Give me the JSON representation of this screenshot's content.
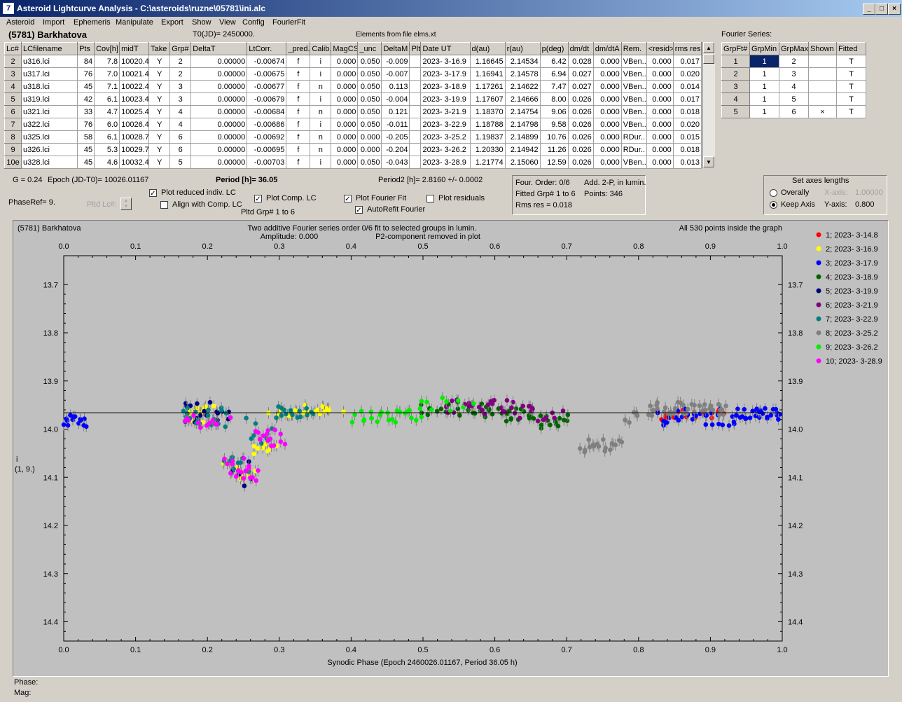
{
  "window": {
    "title": "Asteroid Lightcurve Analysis - C:\\asteroids\\ruzne\\05781\\ini.alc",
    "icon_name": "app-icon"
  },
  "menu": [
    "Asteroid",
    "Import",
    "Ephemeris",
    "Manipulate",
    "Export",
    "Show",
    "View",
    "Config",
    "FourierFit"
  ],
  "header": {
    "asteroid": "(5781) Barkhatova",
    "t0": "T0(JD)= 2450000.",
    "elements": "Elements from file elms.xt"
  },
  "lc_table": {
    "columns": [
      "Lc#",
      "LCfilename",
      "Pts",
      "Cov[h]",
      "midT",
      "Take",
      "Grp#",
      "DeltaT",
      "LtCorr.",
      "_pred.",
      "Calib.",
      "MagCS",
      "_unc",
      "DeltaM",
      "Plt",
      "Date UT",
      "d(au)",
      "r(au)",
      "p(deg)",
      "dm/dt",
      "dm/dtA",
      "Rem.",
      "<resid>",
      "rms res"
    ],
    "rows": [
      [
        "2",
        "u316.lci",
        "84",
        "7.8",
        "10020.4",
        "Y",
        "2",
        "0.00000",
        "-0.00674",
        "f",
        "i",
        "0.000",
        "0.050",
        "-0.009",
        "",
        "2023- 3-16.9",
        "1.16645",
        "2.14534",
        "6.42",
        "0.028",
        "0.000",
        "VBen..",
        "0.000",
        "0.017"
      ],
      [
        "3",
        "u317.lci",
        "76",
        "7.0",
        "10021.4",
        "Y",
        "2",
        "0.00000",
        "-0.00675",
        "f",
        "i",
        "0.000",
        "0.050",
        "-0.007",
        "",
        "2023- 3-17.9",
        "1.16941",
        "2.14578",
        "6.94",
        "0.027",
        "0.000",
        "VBen..",
        "0.000",
        "0.020"
      ],
      [
        "4",
        "u318.lci",
        "45",
        "7.1",
        "10022.4",
        "Y",
        "3",
        "0.00000",
        "-0.00677",
        "f",
        "n",
        "0.000",
        "0.050",
        "0.113",
        "",
        "2023- 3-18.9",
        "1.17261",
        "2.14622",
        "7.47",
        "0.027",
        "0.000",
        "VBen..",
        "0.000",
        "0.014"
      ],
      [
        "5",
        "u319.lci",
        "42",
        "6.1",
        "10023.4",
        "Y",
        "3",
        "0.00000",
        "-0.00679",
        "f",
        "i",
        "0.000",
        "0.050",
        "-0.004",
        "",
        "2023- 3-19.9",
        "1.17607",
        "2.14666",
        "8.00",
        "0.026",
        "0.000",
        "VBen..",
        "0.000",
        "0.017"
      ],
      [
        "6",
        "u321.lci",
        "33",
        "4.7",
        "10025.4",
        "Y",
        "4",
        "0.00000",
        "-0.00684",
        "f",
        "n",
        "0.000",
        "0.050",
        "0.121",
        "",
        "2023- 3-21.9",
        "1.18370",
        "2.14754",
        "9.06",
        "0.026",
        "0.000",
        "VBen..",
        "0.000",
        "0.018"
      ],
      [
        "7",
        "u322.lci",
        "76",
        "6.0",
        "10026.4",
        "Y",
        "4",
        "0.00000",
        "-0.00686",
        "f",
        "i",
        "0.000",
        "0.050",
        "-0.011",
        "",
        "2023- 3-22.9",
        "1.18788",
        "2.14798",
        "9.58",
        "0.026",
        "0.000",
        "VBen..",
        "0.000",
        "0.020"
      ],
      [
        "8",
        "u325.lci",
        "58",
        "6.1",
        "10028.7",
        "Y",
        "6",
        "0.00000",
        "-0.00692",
        "f",
        "n",
        "0.000",
        "0.000",
        "-0.205",
        "",
        "2023- 3-25.2",
        "1.19837",
        "2.14899",
        "10.76",
        "0.026",
        "0.000",
        "RDur..",
        "0.000",
        "0.015"
      ],
      [
        "9",
        "u326.lci",
        "45",
        "5.3",
        "10029.7",
        "Y",
        "6",
        "0.00000",
        "-0.00695",
        "f",
        "n",
        "0.000",
        "0.000",
        "-0.204",
        "",
        "2023- 3-26.2",
        "1.20330",
        "2.14942",
        "11.26",
        "0.026",
        "0.000",
        "RDur..",
        "0.000",
        "0.018"
      ],
      [
        "10e",
        "u328.lci",
        "45",
        "4.6",
        "10032.4",
        "Y",
        "5",
        "0.00000",
        "-0.00703",
        "f",
        "i",
        "0.000",
        "0.050",
        "-0.043",
        "",
        "2023- 3-28.9",
        "1.21774",
        "2.15060",
        "12.59",
        "0.026",
        "0.000",
        "VBen..",
        "0.000",
        "0.013"
      ]
    ]
  },
  "fourier_table": {
    "title": "Fourier Series:",
    "columns": [
      "GrpFt#",
      "GrpMin",
      "GrpMax",
      "Shown",
      "Fitted"
    ],
    "rows": [
      [
        "1",
        "1",
        "2",
        "",
        "T"
      ],
      [
        "2",
        "1",
        "3",
        "",
        "T"
      ],
      [
        "3",
        "1",
        "4",
        "",
        "T"
      ],
      [
        "4",
        "1",
        "5",
        "",
        "T"
      ],
      [
        "5",
        "1",
        "6",
        "×",
        "T"
      ]
    ]
  },
  "info": {
    "g": "G = 0.24",
    "epoch": "Epoch (JD-T0)= 10026.01167",
    "period": "Period [h]= 36.05",
    "period2": "Period2 [h]= 2.8160 +/- 0.0002",
    "phaseref": "PhaseRef= 9.",
    "pltd_lc": "Pltd Lc#:",
    "pltd_grp": "Pltd Grp#  1   to   6"
  },
  "checkboxes": {
    "plot_reduced": {
      "label": "Plot reduced indiv. LC",
      "checked": true
    },
    "align_comp": {
      "label": "Align with Comp. LC",
      "checked": false
    },
    "plot_comp": {
      "label": "Plot Comp. LC",
      "checked": true
    },
    "plot_fourier": {
      "label": "Plot Fourier Fit",
      "checked": true
    },
    "plot_residuals": {
      "label": "Plot residuals",
      "checked": false
    },
    "autorefit": {
      "label": "AutoRefit Fourier",
      "checked": true
    }
  },
  "fourier_info": {
    "order": "Four. Order:  0/6",
    "add": "Add. 2-P, in lumin.",
    "fitted": "Fitted Grp# 1 to 6",
    "points": "Points: 346",
    "rms": "Rms res     = 0.018"
  },
  "axes_box": {
    "title": "Set axes lengths",
    "overall": "Overally",
    "keep": "Keep Axis",
    "xaxis_label": "X-axis:",
    "xaxis_value": "1.00000",
    "yaxis_label": "Y-axis:",
    "yaxis_value": "0.800",
    "selected": "keep"
  },
  "status": {
    "phase": "Phase:",
    "mag": "Mag:"
  },
  "chart_data": {
    "type": "scatter",
    "title": "Two additive Fourier series order 0/6 fit to selected groups in lumin.",
    "subtitle_amp": "Amplitude: 0.000",
    "subtitle_p2": "P2-component removed in plot",
    "object_label": "(5781) Barkhatova",
    "points_note": "All 530 points inside the graph",
    "xlabel": "Synodic Phase (Epoch 2460026.01167, Period 36.05 h)",
    "ylabel": "i",
    "ylabel2": "(1, 9.)",
    "xlim": [
      0,
      1
    ],
    "ylim": [
      14.44,
      13.64
    ],
    "y_inverted": true,
    "xticks": [
      "0.0",
      "0.1",
      "0.2",
      "0.3",
      "0.4",
      "0.5",
      "0.6",
      "0.7",
      "0.8",
      "0.9",
      "1.0"
    ],
    "yticks": [
      "13.7",
      "13.8",
      "13.9",
      "14.0",
      "14.1",
      "14.2",
      "14.3",
      "14.4"
    ],
    "fit_line_y": 13.966,
    "legend_position": "right",
    "series": [
      {
        "name": "1; 2023- 3-14.8",
        "color": "#ff0000",
        "segments": [
          [
            0.825,
            0.005,
            0.92,
            13.968,
            0.012,
            18
          ]
        ]
      },
      {
        "name": "2; 2023- 3-16.9",
        "color": "#ffff00",
        "segments": [
          [
            0.165,
            0.012,
            0.205,
            13.97,
            0.018,
            14
          ],
          [
            0.225,
            0.006,
            0.245,
            14.08,
            0.02,
            4
          ],
          [
            0.245,
            0.005,
            0.265,
            14.095,
            0.02,
            4
          ],
          [
            0.265,
            0.006,
            0.29,
            14.035,
            0.018,
            8
          ],
          [
            0.29,
            0.008,
            0.33,
            13.965,
            0.01,
            10
          ],
          [
            0.33,
            0.01,
            0.38,
            13.96,
            0.01,
            16
          ]
        ]
      },
      {
        "name": "3; 2023- 3-17.9",
        "color": "#0000ff",
        "segments": [
          [
            0.0,
            0.002,
            0.032,
            13.983,
            0.012,
            14
          ],
          [
            0.83,
            0.006,
            0.935,
            13.975,
            0.018,
            28
          ],
          [
            0.935,
            0.006,
            1.0,
            13.968,
            0.012,
            30
          ]
        ]
      },
      {
        "name": "4; 2023- 3-18.9",
        "color": "#006400",
        "segments": [
          [
            0.495,
            0.005,
            0.59,
            13.958,
            0.014,
            20
          ],
          [
            0.59,
            0.008,
            0.65,
            13.97,
            0.014,
            16
          ],
          [
            0.65,
            0.004,
            0.705,
            13.985,
            0.016,
            16
          ]
        ]
      },
      {
        "name": "5; 2023- 3-19.9",
        "color": "#000080",
        "segments": [
          [
            0.165,
            0.006,
            0.23,
            13.965,
            0.022,
            18
          ],
          [
            0.23,
            0.004,
            0.26,
            14.09,
            0.03,
            6
          ]
        ]
      },
      {
        "name": "6; 2023- 3-21.9",
        "color": "#800080",
        "segments": [
          [
            0.535,
            0.006,
            0.62,
            13.955,
            0.016,
            22
          ],
          [
            0.62,
            0.006,
            0.69,
            13.968,
            0.016,
            16
          ]
        ]
      },
      {
        "name": "7; 2023- 3-22.9",
        "color": "#008080",
        "segments": [
          [
            0.165,
            0.008,
            0.225,
            13.975,
            0.02,
            20
          ],
          [
            0.225,
            0.003,
            0.255,
            14.075,
            0.03,
            8
          ],
          [
            0.255,
            0.003,
            0.29,
            14.0,
            0.03,
            8
          ],
          [
            0.29,
            0.006,
            0.345,
            13.965,
            0.012,
            16
          ]
        ]
      },
      {
        "name": "8; 2023- 3-25.2",
        "color": "#808080",
        "segments": [
          [
            0.72,
            0.002,
            0.775,
            14.035,
            0.015,
            18
          ],
          [
            0.775,
            0.008,
            0.815,
            13.975,
            0.012,
            8
          ],
          [
            0.815,
            0.004,
            0.925,
            13.958,
            0.014,
            34
          ]
        ]
      },
      {
        "name": "9; 2023- 3-26.2",
        "color": "#00ee00",
        "segments": [
          [
            0.405,
            0.004,
            0.495,
            13.975,
            0.014,
            24
          ],
          [
            0.495,
            0.008,
            0.565,
            13.95,
            0.016,
            10
          ]
        ]
      },
      {
        "name": "10; 2023- 3-28.9",
        "color": "#ff00ff",
        "segments": [
          [
            0.165,
            0.01,
            0.225,
            13.985,
            0.015,
            12
          ],
          [
            0.225,
            0.002,
            0.25,
            14.08,
            0.02,
            10
          ],
          [
            0.25,
            0.002,
            0.27,
            14.09,
            0.02,
            8
          ],
          [
            0.27,
            0.003,
            0.305,
            14.02,
            0.02,
            14
          ]
        ]
      }
    ]
  }
}
